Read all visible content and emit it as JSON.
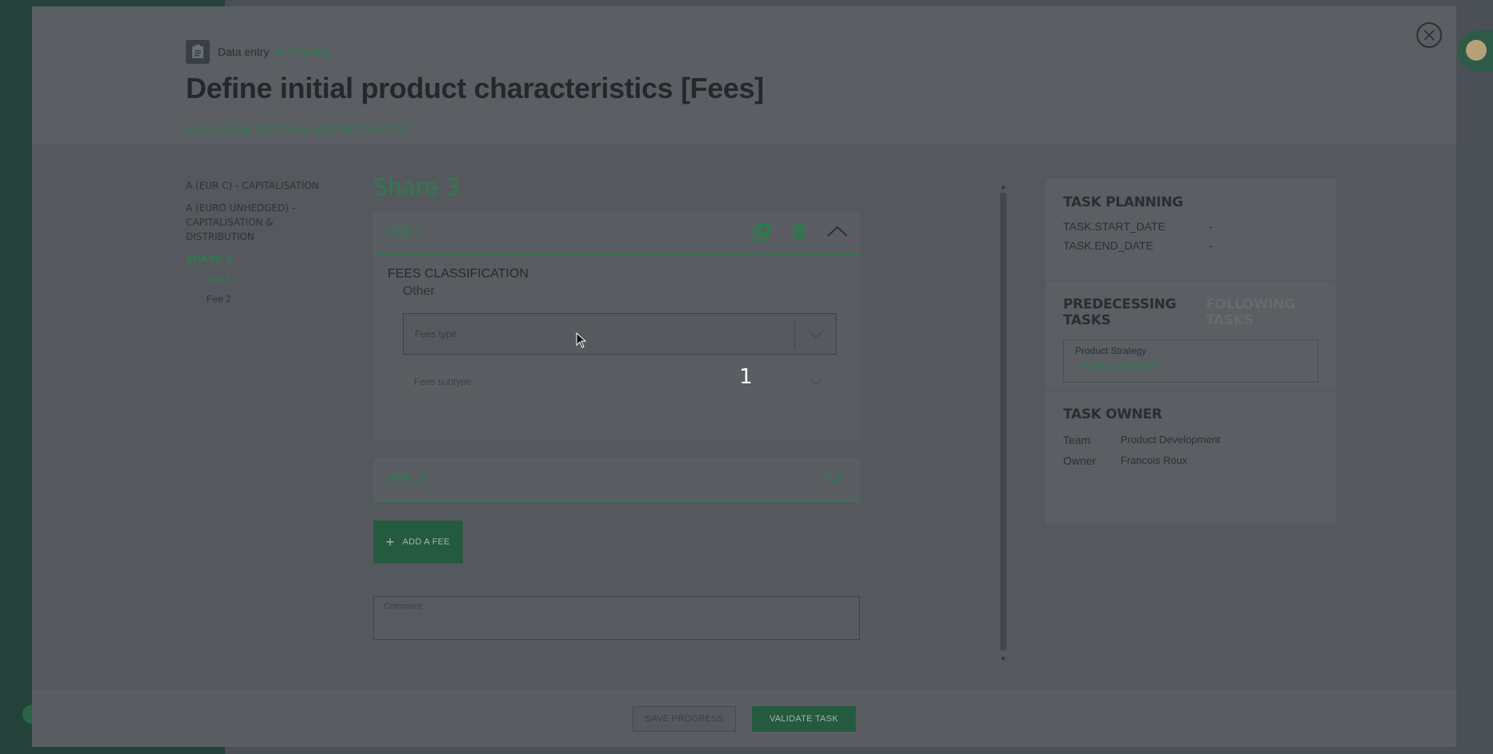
{
  "header": {
    "type_label": "Data entry",
    "status": "Ongoing",
    "title": "Define initial product characteristics [Fees]",
    "breadcrumb": "SINGLE FUND CREATION / DISTINCT PARVEST"
  },
  "share_nav": {
    "shares": [
      {
        "label": "A (EUR C) - CAPITALISATION"
      },
      {
        "label": "A (EURO UNHEDGED) - CAPITALISATION & DISTRIBUTION"
      },
      {
        "label": "SHARE 3"
      }
    ],
    "subs": [
      {
        "label": "Fee 1"
      },
      {
        "label": "Fee 2"
      }
    ]
  },
  "main": {
    "share_title": "Share 3",
    "fee1": {
      "label": "FEE 1",
      "classification_title": "FEES CLASSIFICATION",
      "classification_sub": "Other",
      "fees_type_placeholder": "Fees type",
      "fees_subtype_placeholder": "Fees subtype"
    },
    "fee2": {
      "label": "FEE 2"
    },
    "add_fee_label": "ADD A FEE",
    "comment_placeholder": "Comment"
  },
  "side": {
    "planning_title": "TASK PLANNING",
    "start_key": "TASK.START_DATE",
    "start_value": "-",
    "end_key": "TASK.END_DATE",
    "end_value": "-",
    "tab_predecessing": "PREDECESSING TASKS",
    "tab_following": "FOLLOWING TASKS",
    "dep_category": "Product Strategy",
    "dep_link": "- Project validation",
    "owner_title": "TASK OWNER",
    "team_key": "Team",
    "team_value": "Product Development",
    "owner_key": "Owner",
    "owner_value": "Francois Roux"
  },
  "footer": {
    "save_label": "SAVE PROGRESS",
    "validate_label": "VALIDATE TASK"
  },
  "overlay": {
    "step_marker": "1"
  },
  "colors": {
    "accent": "#2e7a50",
    "button": "#245a3e",
    "modal_bg": "#55595e"
  }
}
